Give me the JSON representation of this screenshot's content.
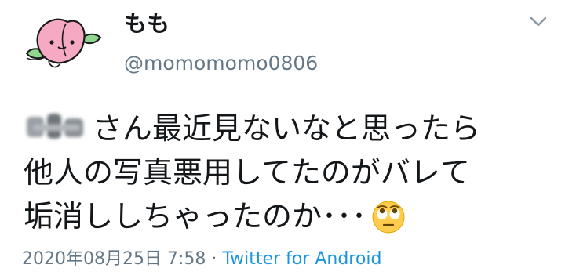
{
  "user": {
    "display_name": "もも",
    "handle": "@momomomo0806",
    "avatar_icon": "peach-avatar-icon"
  },
  "menu_icon": "chevron-down-icon",
  "tweet": {
    "line1_text": "さん最近見ないなと思ったら",
    "line2_text": "他人の写真悪用してたのがバレて",
    "line3_text": "垢消ししちゃったのか･･･",
    "emoji": "face-with-rolling-eyes-emoji",
    "redacted_name_icon": "blurred-username"
  },
  "meta": {
    "timestamp": "2020年08月25日 7:58",
    "separator": "·",
    "source": "Twitter for Android"
  },
  "colors": {
    "text": "#14171a",
    "secondary": "#657786",
    "link": "#1b95e0",
    "peach_pink": "#f4a8c0",
    "leaf_green": "#7ed07e"
  }
}
